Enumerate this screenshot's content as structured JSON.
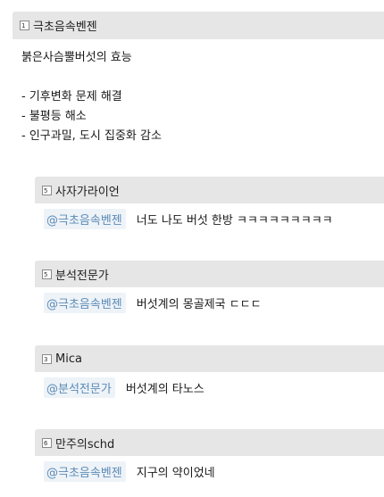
{
  "post": {
    "level": "1",
    "author": "극초음속벤젠",
    "lines": [
      "붉은사슴뿔버섯의 효능",
      "",
      "- 기후변화 문제 해결",
      "- 불평등 해소",
      "- 인구과밀, 도시 집중화 감소"
    ]
  },
  "replies": [
    {
      "level": "5",
      "author": "사자가라이언",
      "mention": "@극초음속벤젠",
      "text": "너도 나도 버섯 한방 ㅋㅋㅋㅋㅋㅋㅋㅋㅋ"
    },
    {
      "level": "5",
      "author": "분석전문가",
      "mention": "@극초음속벤젠",
      "text": "버섯계의 몽골제국 ㄷㄷㄷ"
    },
    {
      "level": "3",
      "author": "Mica",
      "mention": "@분석전문가",
      "text": "버섯계의 타노스"
    },
    {
      "level": "6",
      "author": "만주의schd",
      "mention": "@극초음속벤젠",
      "text": "지구의 약이었네"
    }
  ]
}
